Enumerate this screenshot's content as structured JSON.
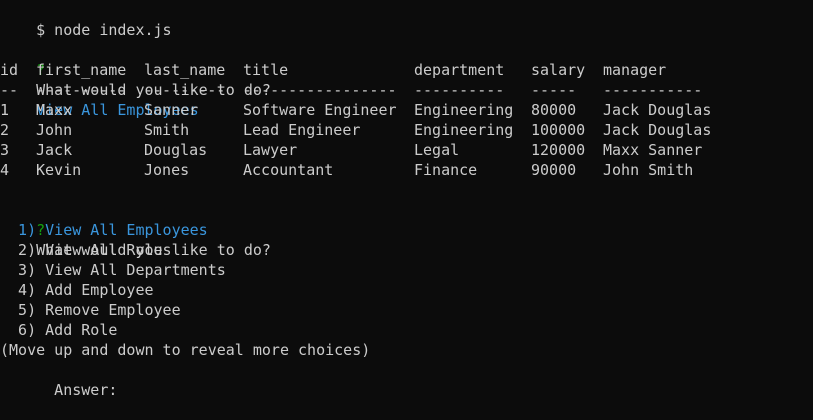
{
  "top_partial": "$ node index.js",
  "prompt1": {
    "mark": "?",
    "question": "What would you like to do?",
    "answer": "View All Employees"
  },
  "table": {
    "headers": [
      "id",
      "first_name",
      "last_name",
      "title",
      "department",
      "salary",
      "manager"
    ],
    "separators": [
      "--",
      "----------",
      "---------",
      "-----------------",
      "----------",
      "-----",
      "-----------"
    ],
    "rows": [
      [
        "1",
        "Maxx",
        "Sanner",
        "Software Engineer",
        "Engineering",
        "80000",
        "Jack Douglas"
      ],
      [
        "2",
        "John",
        "Smith",
        "Lead Engineer",
        "Engineering",
        "100000",
        "Jack Douglas"
      ],
      [
        "3",
        "Jack",
        "Douglas",
        "Lawyer",
        "Legal",
        "120000",
        "Maxx Sanner"
      ],
      [
        "4",
        "Kevin",
        "Jones",
        "Accountant",
        "Finance",
        "90000",
        "John Smith"
      ]
    ]
  },
  "prompt2": {
    "mark": "?",
    "question": "What would you like to do?",
    "choices": [
      "  1) View All Employees",
      "  2) View All Roles",
      "  3) View All Departments",
      "  4) Add Employee",
      "  5) Remove Employee",
      "  6) Add Role"
    ],
    "hint": "(Move up and down to reveal more choices)",
    "answer_label": "  Answer:"
  },
  "colors": {
    "background": "#0c0c0c",
    "text": "#cccccc",
    "prompt_mark": "#13a10e",
    "highlight": "#3a96dd"
  }
}
